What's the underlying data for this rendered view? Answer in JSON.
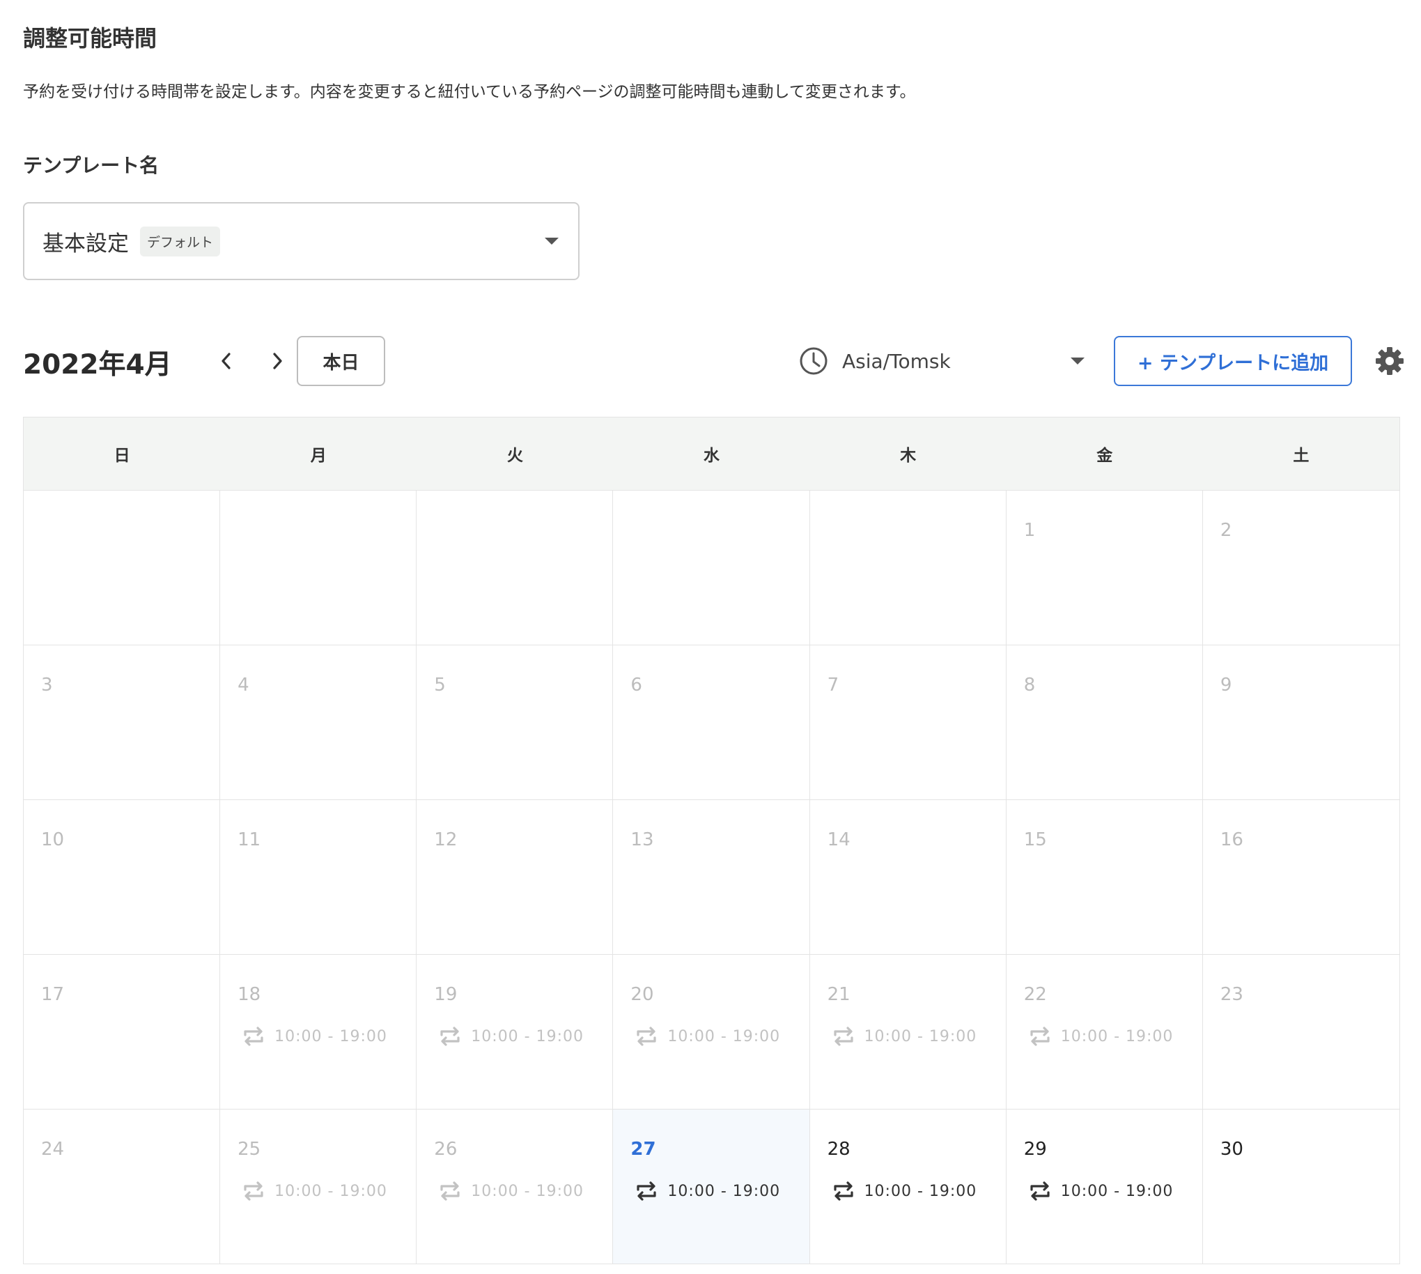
{
  "header": {
    "title": "調整可能時間",
    "description": "予約を受け付ける時間帯を設定します。内容を変更すると紐付いている予約ページの調整可能時間も連動して変更されます。"
  },
  "template": {
    "label": "テンプレート名",
    "selected": "基本設定",
    "badge": "デフォルト"
  },
  "toolbar": {
    "month": "2022年4月",
    "today_label": "本日",
    "timezone": "Asia/Tomsk",
    "add_template_label": "+ テンプレートに追加"
  },
  "calendar": {
    "weekdays": [
      "日",
      "月",
      "火",
      "水",
      "木",
      "金",
      "土"
    ],
    "weeks": [
      [
        {
          "day": ""
        },
        {
          "day": ""
        },
        {
          "day": ""
        },
        {
          "day": ""
        },
        {
          "day": ""
        },
        {
          "day": "1"
        },
        {
          "day": "2"
        }
      ],
      [
        {
          "day": "3"
        },
        {
          "day": "4"
        },
        {
          "day": "5"
        },
        {
          "day": "6"
        },
        {
          "day": "7"
        },
        {
          "day": "8"
        },
        {
          "day": "9"
        }
      ],
      [
        {
          "day": "10"
        },
        {
          "day": "11"
        },
        {
          "day": "12"
        },
        {
          "day": "13"
        },
        {
          "day": "14"
        },
        {
          "day": "15"
        },
        {
          "day": "16"
        }
      ],
      [
        {
          "day": "17"
        },
        {
          "day": "18",
          "slot": "10:00 - 19:00"
        },
        {
          "day": "19",
          "slot": "10:00 - 19:00"
        },
        {
          "day": "20",
          "slot": "10:00 - 19:00"
        },
        {
          "day": "21",
          "slot": "10:00 - 19:00"
        },
        {
          "day": "22",
          "slot": "10:00 - 19:00"
        },
        {
          "day": "23"
        }
      ],
      [
        {
          "day": "24"
        },
        {
          "day": "25",
          "slot": "10:00 - 19:00"
        },
        {
          "day": "26",
          "slot": "10:00 - 19:00"
        },
        {
          "day": "27",
          "slot": "10:00 - 19:00",
          "today": true,
          "active": true
        },
        {
          "day": "28",
          "slot": "10:00 - 19:00",
          "active": true
        },
        {
          "day": "29",
          "slot": "10:00 - 19:00",
          "active": true
        },
        {
          "day": "30",
          "active": true
        }
      ]
    ]
  },
  "colors": {
    "accent": "#2f6fd6",
    "header_bg": "#f3f5f3",
    "today_bg": "#f5f9fd",
    "muted_text": "#bcbcbc"
  },
  "icons": {
    "prev": "chevron-left-icon",
    "next": "chevron-right-icon",
    "clock": "clock-icon",
    "settings": "gear-icon",
    "repeat": "repeat-icon",
    "dropdown": "caret-down-icon"
  }
}
